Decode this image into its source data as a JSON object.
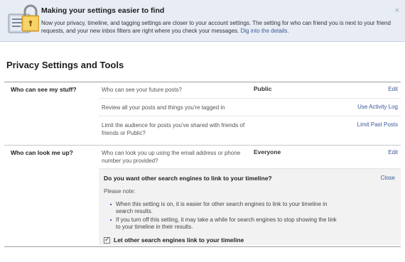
{
  "notice": {
    "title": "Making your settings easier to find",
    "body": "Now your privacy, timeline, and tagging settings are closer to your account settings. The setting for who can friend you is next to your friend requests, and your new inbox filters are right where you check your messages.",
    "link": "Dig into the details.",
    "close": "×",
    "icon": "lock-settings-icon"
  },
  "page": {
    "title": "Privacy Settings and Tools"
  },
  "sections": [
    {
      "label": "Who can see my stuff?",
      "rows": [
        {
          "desc": "Who can see your future posts?",
          "value": "Public",
          "action": "Edit"
        },
        {
          "desc": "Review all your posts and things you're tagged in",
          "value": "",
          "action": "Use Activity Log"
        },
        {
          "desc": "Limit the audience for posts you've shared with friends of friends or Public?",
          "value": "",
          "action": "Limit Past Posts"
        }
      ]
    },
    {
      "label": "Who can look me up?",
      "rows": [
        {
          "desc": "Who can look you up using the email address or phone number you provided?",
          "value": "Everyone",
          "action": "Edit"
        }
      ]
    }
  ],
  "panel": {
    "title": "Do you want other search engines to link to your timeline?",
    "close": "Close",
    "note": "Please note:",
    "bullets": [
      "When this setting is on, it is easier for other search engines to link to your timeline in search results.",
      "If you turn off this setting, it may take a while for search engines to stop showing the link to your timeline in their results."
    ],
    "checkbox_label": "Let other search engines link to your timeline",
    "checkbox_checked": true
  },
  "colors": {
    "link": "#3b5998",
    "notice_bg": "#e7ecf5",
    "panel_bg": "#f2f2f2"
  }
}
